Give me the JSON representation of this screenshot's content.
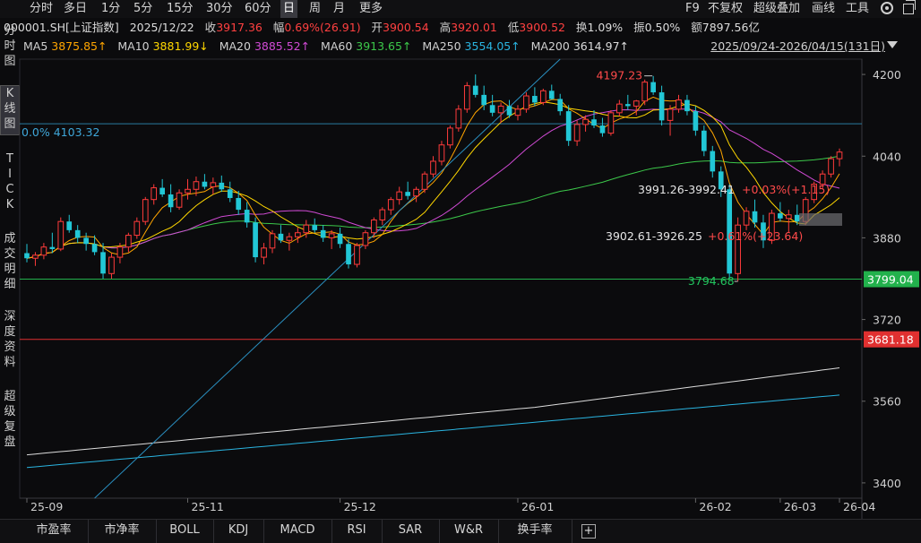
{
  "toolbar": {
    "periods": [
      "分时",
      "多日",
      "1分",
      "5分",
      "15分",
      "30分",
      "60分",
      "日",
      "周",
      "月",
      "更多"
    ],
    "active_period": "日",
    "f9": "F9",
    "not_restored": "不复权",
    "overlay": "超级叠加",
    "draw": "画线",
    "tools": "工具"
  },
  "quote": {
    "code": "000001.SH[上证指数]",
    "date": "2025/12/22",
    "close_label": "收",
    "close": "3917.36",
    "change_label": "幅",
    "change": "0.69%(26.91)",
    "open_label": "开",
    "open": "3900.54",
    "high_label": "高",
    "high": "3920.01",
    "low_label": "低",
    "low": "3900.52",
    "turnover_label": "换",
    "turnover": "1.09%",
    "amplitude_label": "振",
    "amplitude": "0.50%",
    "amount_label": "额",
    "amount": "7897.56亿"
  },
  "ma": {
    "ma5_label": "MA5",
    "ma5": "3875.85↑",
    "ma5_color": "#ffa500",
    "ma10_label": "MA10",
    "ma10": "3881.99↓",
    "ma10_color": "#ffd700",
    "ma20_label": "MA20",
    "ma20": "3885.52↑",
    "ma20_color": "#d04ad4",
    "ma60_label": "MA60",
    "ma60": "3913.65↑",
    "ma60_color": "#3cc84a",
    "ma250_label": "MA250",
    "ma250": "3554.05↑",
    "ma250_color": "#2ab4e0",
    "ma200_label": "MA200",
    "ma200": "3614.97↑",
    "ma200_color": "#dcdcdc"
  },
  "range": "2025/09/24-2026/04/15(131日)",
  "side_tabs": [
    "分\n时\n图",
    "K\n线\n图",
    "T\nI\nC\nK",
    "成\n交\n明\n细",
    "深\n度\n资\n料",
    "超\n级\n复\n盘"
  ],
  "side_active": "K\n线\n图",
  "chart_data": {
    "type": "candlestick",
    "y_ticks": [
      "4200",
      "4040",
      "3880",
      "3720",
      "3560",
      "3400"
    ],
    "x_ticks": [
      "25-09",
      "25-11",
      "25-12",
      "26-01",
      "26-02",
      "26-03",
      "26-04"
    ],
    "ylim": [
      3370,
      4230
    ],
    "price_tags": [
      {
        "value": 3799.04,
        "label": "3799.04",
        "color": "#22b14c"
      },
      {
        "value": 3681.18,
        "label": "3681.18",
        "color": "#e03030"
      }
    ],
    "hline_label": {
      "value": 4103.32,
      "label": "0.0%  4103.32"
    },
    "annotations": [
      {
        "label": "4197.23",
        "color": "#ff4a4a"
      },
      {
        "label": "3794.68",
        "color": "#22c55e"
      },
      {
        "label": "3991.26-3992.41",
        "color": "#e6e6e6",
        "extra": "+0.03%(+1.15)",
        "extra_color": "#ff4a4a"
      },
      {
        "label": "3902.61-3926.25",
        "color": "#e6e6e6",
        "extra": "+0.61%(+23.64)",
        "extra_color": "#ff4a4a"
      }
    ],
    "candles": [
      [
        3850,
        3868,
        3832,
        3840
      ],
      [
        3840,
        3852,
        3825,
        3846
      ],
      [
        3846,
        3870,
        3838,
        3862
      ],
      [
        3862,
        3890,
        3850,
        3858
      ],
      [
        3858,
        3920,
        3854,
        3912
      ],
      [
        3912,
        3925,
        3890,
        3895
      ],
      [
        3895,
        3905,
        3870,
        3880
      ],
      [
        3880,
        3890,
        3855,
        3868
      ],
      [
        3868,
        3885,
        3846,
        3852
      ],
      [
        3852,
        3870,
        3800,
        3810
      ],
      [
        3810,
        3850,
        3800,
        3842
      ],
      [
        3842,
        3870,
        3830,
        3862
      ],
      [
        3862,
        3890,
        3852,
        3885
      ],
      [
        3885,
        3920,
        3878,
        3912
      ],
      [
        3912,
        3960,
        3905,
        3955
      ],
      [
        3955,
        3985,
        3945,
        3978
      ],
      [
        3978,
        3995,
        3960,
        3965
      ],
      [
        3965,
        3985,
        3930,
        3940
      ],
      [
        3940,
        3975,
        3935,
        3968
      ],
      [
        3968,
        3995,
        3955,
        3975
      ],
      [
        3975,
        4000,
        3962,
        3990
      ],
      [
        3990,
        4005,
        3975,
        3980
      ],
      [
        3980,
        3998,
        3965,
        3988
      ],
      [
        3988,
        4002,
        3970,
        3975
      ],
      [
        3975,
        3990,
        3950,
        3958
      ],
      [
        3958,
        3972,
        3925,
        3935
      ],
      [
        3935,
        3950,
        3900,
        3910
      ],
      [
        3910,
        3920,
        3832,
        3842
      ],
      [
        3842,
        3870,
        3828,
        3860
      ],
      [
        3860,
        3895,
        3850,
        3888
      ],
      [
        3888,
        3905,
        3870,
        3875
      ],
      [
        3875,
        3890,
        3855,
        3882
      ],
      [
        3882,
        3900,
        3870,
        3890
      ],
      [
        3890,
        3915,
        3880,
        3905
      ],
      [
        3905,
        3918,
        3890,
        3895
      ],
      [
        3895,
        3905,
        3872,
        3880
      ],
      [
        3880,
        3895,
        3858,
        3888
      ],
      [
        3888,
        3900,
        3860,
        3868
      ],
      [
        3868,
        3878,
        3820,
        3828
      ],
      [
        3828,
        3870,
        3822,
        3865
      ],
      [
        3865,
        3895,
        3858,
        3890
      ],
      [
        3890,
        3920,
        3880,
        3915
      ],
      [
        3915,
        3940,
        3905,
        3935
      ],
      [
        3935,
        3960,
        3925,
        3955
      ],
      [
        3955,
        3980,
        3945,
        3970
      ],
      [
        3970,
        3990,
        3955,
        3962
      ],
      [
        3962,
        3980,
        3950,
        3975
      ],
      [
        3975,
        4010,
        3968,
        4005
      ],
      [
        4005,
        4040,
        3998,
        4030
      ],
      [
        4030,
        4070,
        4022,
        4062
      ],
      [
        4062,
        4100,
        4055,
        4095
      ],
      [
        4095,
        4140,
        4088,
        4132
      ],
      [
        4132,
        4185,
        4125,
        4178
      ],
      [
        4178,
        4200,
        4155,
        4160
      ],
      [
        4160,
        4178,
        4130,
        4140
      ],
      [
        4140,
        4160,
        4118,
        4125
      ],
      [
        4125,
        4145,
        4105,
        4138
      ],
      [
        4138,
        4150,
        4115,
        4120
      ],
      [
        4120,
        4140,
        4110,
        4132
      ],
      [
        4132,
        4165,
        4125,
        4158
      ],
      [
        4158,
        4175,
        4138,
        4145
      ],
      [
        4145,
        4172,
        4140,
        4168
      ],
      [
        4168,
        4180,
        4150,
        4152
      ],
      [
        4152,
        4162,
        4120,
        4128
      ],
      [
        4128,
        4140,
        4060,
        4070
      ],
      [
        4070,
        4110,
        4060,
        4102
      ],
      [
        4102,
        4120,
        4088,
        4112
      ],
      [
        4112,
        4130,
        4095,
        4100
      ],
      [
        4100,
        4115,
        4078,
        4085
      ],
      [
        4085,
        4130,
        4080,
        4125
      ],
      [
        4125,
        4150,
        4118,
        4142
      ],
      [
        4142,
        4160,
        4130,
        4138
      ],
      [
        4138,
        4150,
        4120,
        4148
      ],
      [
        4148,
        4190,
        4140,
        4185
      ],
      [
        4185,
        4197,
        4160,
        4165
      ],
      [
        4165,
        4178,
        4100,
        4110
      ],
      [
        4110,
        4140,
        4080,
        4132
      ],
      [
        4132,
        4160,
        4125,
        4150
      ],
      [
        4150,
        4160,
        4120,
        4128
      ],
      [
        4128,
        4138,
        4080,
        4090
      ],
      [
        4090,
        4100,
        4040,
        4050
      ],
      [
        4050,
        4060,
        3998,
        4010
      ],
      [
        4010,
        4020,
        3960,
        3975
      ],
      [
        3975,
        3985,
        3800,
        3810
      ],
      [
        3810,
        3920,
        3795,
        3905
      ],
      [
        3905,
        3940,
        3895,
        3932
      ],
      [
        3932,
        3955,
        3900,
        3910
      ],
      [
        3910,
        3925,
        3860,
        3875
      ],
      [
        3875,
        3935,
        3868,
        3928
      ],
      [
        3928,
        3950,
        3912,
        3918
      ],
      [
        3918,
        3935,
        3890,
        3925
      ],
      [
        3925,
        3945,
        3905,
        3912
      ],
      [
        3912,
        3960,
        3905,
        3955
      ],
      [
        3955,
        3990,
        3948,
        3985
      ],
      [
        3985,
        4012,
        3975,
        4005
      ],
      [
        4005,
        4040,
        3998,
        4035
      ],
      [
        4035,
        4055,
        4020,
        4048
      ]
    ]
  },
  "bottom_tabs": [
    "市盈率",
    "市净率",
    "BOLL",
    "KDJ",
    "MACD",
    "RSI",
    "SAR",
    "W&R",
    "换手率"
  ],
  "bottom_add": "+"
}
